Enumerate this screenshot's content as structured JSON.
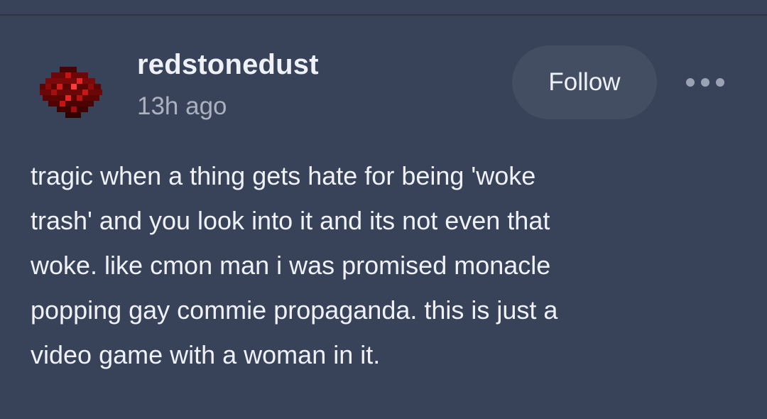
{
  "post": {
    "author": {
      "username": "redstonedust",
      "avatar_icon": "redstone-dust-icon",
      "avatar_colors": [
        "#3a0000",
        "#7a0606",
        "#b00f0f",
        "#e02020"
      ]
    },
    "timestamp": "13h ago",
    "follow_label": "Follow",
    "more_icon": "more-dots-icon",
    "body_lines": [
      "tragic when a thing gets hate for being 'woke",
      "trash' and you look into it and its not even that",
      "woke. like cmon man i was promised monacle",
      "popping gay commie propaganda. this is just a",
      "video game with a woman in it."
    ]
  },
  "colors": {
    "background": "#384359",
    "text": "#eef1f6",
    "muted_text": "#aab1c0",
    "button_bg": "#434e63"
  }
}
